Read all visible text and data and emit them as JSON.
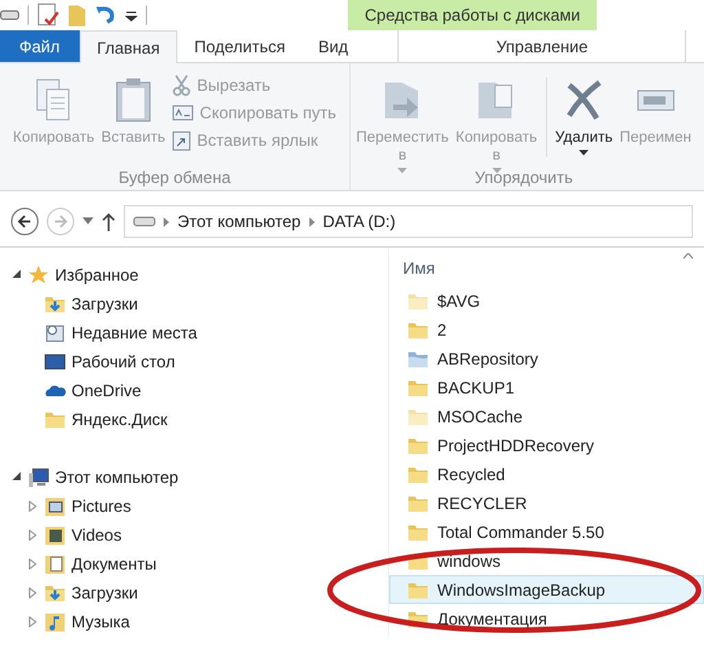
{
  "context_tab_group": {
    "title": "Средства работы с дисками"
  },
  "tabs": [
    {
      "label": "Файл",
      "kind": "file",
      "selected": false
    },
    {
      "label": "Главная",
      "kind": "tab",
      "selected": true
    },
    {
      "label": "Поделиться",
      "kind": "tab",
      "selected": false
    },
    {
      "label": "Вид",
      "kind": "tab",
      "selected": false
    },
    {
      "label": "Управление",
      "kind": "context",
      "selected": false
    }
  ],
  "ribbon": {
    "groups": [
      {
        "label": "Буфер обмена",
        "large": [
          {
            "label": "Копировать",
            "kind": "copy",
            "disabled": true
          },
          {
            "label": "Вставить",
            "kind": "paste",
            "disabled": true
          }
        ],
        "small": [
          {
            "label": "Вырезать",
            "kind": "cut",
            "disabled": true
          },
          {
            "label": "Скопировать путь",
            "kind": "path",
            "disabled": true
          },
          {
            "label": "Вставить ярлык",
            "kind": "shortcut",
            "disabled": true
          }
        ]
      },
      {
        "label": "Упорядочить",
        "large": [
          {
            "label": "Переместить\nв",
            "kind": "move",
            "disabled": true,
            "dropdown": true
          },
          {
            "label": "Копировать\nв",
            "kind": "copyto",
            "disabled": true,
            "dropdown": true
          },
          {
            "label": "Удалить",
            "kind": "delete",
            "disabled": false,
            "dropdown": true
          },
          {
            "label": "Переимен",
            "kind": "rename",
            "disabled": true,
            "dropdown": false
          }
        ]
      }
    ]
  },
  "address": {
    "back_button": {
      "disabled": false
    },
    "forward_button": {
      "disabled": true
    },
    "crumbs": [
      "Этот компьютер",
      "DATA (D:)"
    ]
  },
  "nav_pane": [
    {
      "label": "Избранное",
      "kind": "star",
      "expanded": true,
      "children": [
        {
          "label": "Загрузки",
          "kind": "downloads"
        },
        {
          "label": "Недавние места",
          "kind": "recent"
        },
        {
          "label": "Рабочий стол",
          "kind": "desktop"
        },
        {
          "label": "OneDrive",
          "kind": "cloud"
        },
        {
          "label": "Яндекс.Диск",
          "kind": "folder"
        }
      ]
    },
    {
      "label": "Этот компьютер",
      "kind": "computer",
      "expanded": true,
      "children": [
        {
          "label": "Pictures",
          "kind": "pictures",
          "expanded": false
        },
        {
          "label": "Videos",
          "kind": "videos",
          "expanded": false
        },
        {
          "label": "Документы",
          "kind": "documents",
          "expanded": false
        },
        {
          "label": "Загрузки",
          "kind": "downloads",
          "expanded": false
        },
        {
          "label": "Музыка",
          "kind": "music",
          "expanded": false
        }
      ]
    }
  ],
  "file_list": {
    "column": "Имя",
    "items": [
      {
        "name": "$AVG",
        "kind": "folder",
        "hidden": true,
        "selected": false
      },
      {
        "name": "2",
        "kind": "folder",
        "hidden": false,
        "selected": false
      },
      {
        "name": "ABRepository",
        "kind": "repo",
        "hidden": false,
        "selected": false
      },
      {
        "name": "BACKUP1",
        "kind": "folder",
        "hidden": false,
        "selected": false
      },
      {
        "name": "MSOCache",
        "kind": "folder",
        "hidden": true,
        "selected": false
      },
      {
        "name": "ProjectHDDRecovery",
        "kind": "folder",
        "hidden": false,
        "selected": false
      },
      {
        "name": "Recycled",
        "kind": "folder",
        "hidden": false,
        "selected": false
      },
      {
        "name": "RECYCLER",
        "kind": "folder",
        "hidden": false,
        "selected": false
      },
      {
        "name": "Total Commander 5.50",
        "kind": "folder",
        "hidden": false,
        "selected": false
      },
      {
        "name": "windows",
        "kind": "folder",
        "hidden": false,
        "selected": false
      },
      {
        "name": "WindowsImageBackup",
        "kind": "folder",
        "hidden": false,
        "selected": true
      },
      {
        "name": "Документация",
        "kind": "folder",
        "hidden": false,
        "selected": false
      }
    ]
  }
}
